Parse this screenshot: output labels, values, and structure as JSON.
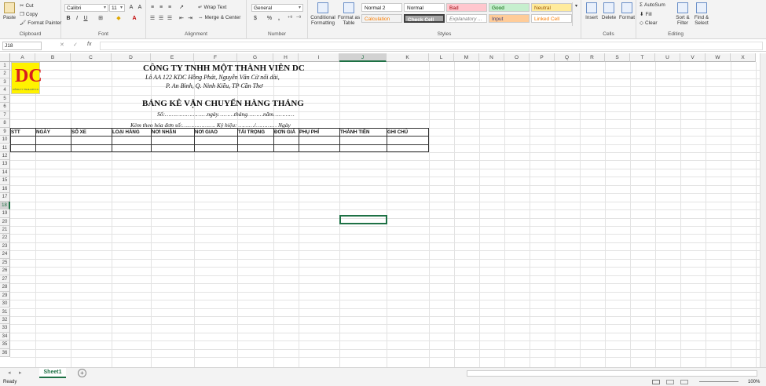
{
  "ribbon": {
    "clipboard": {
      "label": "Clipboard",
      "paste": "Paste",
      "cut": "Cut",
      "copy": "Copy",
      "format_painter": "Format Painter"
    },
    "font": {
      "label": "Font",
      "name": "Calibri",
      "size": "11"
    },
    "alignment": {
      "label": "Alignment",
      "wrap": "Wrap Text",
      "merge": "Merge & Center"
    },
    "number": {
      "label": "Number",
      "format": "General",
      "currency": "$",
      "percent": "%",
      "comma": ","
    },
    "styles": {
      "label": "Styles",
      "conditional": "Conditional Formatting",
      "format_table": "Format as Table",
      "cells": [
        {
          "text": "Normal 2",
          "bg": "#ffffff",
          "fg": "#111111"
        },
        {
          "text": "Normal",
          "bg": "#ffffff",
          "fg": "#111111"
        },
        {
          "text": "Bad",
          "bg": "#ffc7ce",
          "fg": "#9c0006"
        },
        {
          "text": "Good",
          "bg": "#c6efce",
          "fg": "#006100"
        },
        {
          "text": "Neutral",
          "bg": "#ffeb9c",
          "fg": "#9c5700"
        },
        {
          "text": "Calculation",
          "bg": "#f2f2f2",
          "fg": "#fa7d00"
        },
        {
          "text": "Check Cell",
          "bg": "#a5a5a5",
          "fg": "#ffffff"
        },
        {
          "text": "Explanatory ...",
          "bg": "#ffffff",
          "fg": "#7f7f7f"
        },
        {
          "text": "Input",
          "bg": "#ffcc99",
          "fg": "#3f3f76"
        },
        {
          "text": "Linked Cell",
          "bg": "#ffffff",
          "fg": "#fa7d00"
        }
      ]
    },
    "cells": {
      "label": "Cells",
      "insert": "Insert",
      "delete": "Delete",
      "format": "Format"
    },
    "editing": {
      "label": "Editing",
      "autosum": "AutoSum",
      "fill": "Fill",
      "clear": "Clear",
      "sort": "Sort & Filter",
      "find": "Find & Select"
    }
  },
  "formula_bar": {
    "name_box": "J18",
    "fx": "fx",
    "value": ""
  },
  "columns": [
    "A",
    "B",
    "C",
    "D",
    "E",
    "F",
    "G",
    "H",
    "I",
    "J",
    "K",
    "L",
    "M",
    "N",
    "O",
    "P",
    "Q",
    "R",
    "S",
    "T",
    "U",
    "V",
    "W",
    "X"
  ],
  "rows": [
    "1",
    "2",
    "3",
    "4",
    "5",
    "6",
    "7",
    "8",
    "9",
    "10",
    "11",
    "12",
    "13",
    "14",
    "15",
    "16",
    "17",
    "18",
    "19",
    "20",
    "21",
    "22",
    "23",
    "24",
    "25",
    "26",
    "27",
    "28",
    "29",
    "30",
    "31",
    "32",
    "33",
    "34",
    "35",
    "36"
  ],
  "sheet": {
    "company": "CÔNG TY TNHH MỘT THÀNH VIÊN DC",
    "address1": "Lô AA 122 KDC Hồng Phát, Nguyễn Văn Cừ nối dài,",
    "address2": "P. An Bình, Q. Ninh Kiều, TP Cần Thơ",
    "title": "BẢNG KÊ VẬN CHUYỂN HÀNG THÁNG",
    "number_line": "Số:……………………ngày………tháng………năm…………",
    "invoice_line": "Kèm theo hóa đơn số:………………. Ký hiệu:  ………/…………  Ngày",
    "logo_text": "DC",
    "logo_caption": "CÔNG TY TNHH MTV DC",
    "headers": [
      "STT",
      "NGÀY",
      "SỐ XE",
      "LOẠI HÀNG",
      "NƠI NHẬN",
      "NƠI GIAO",
      "TẢI TRỌNG",
      "ĐƠN GIÁ",
      "PHỤ PHÍ",
      "THÀNH TIỀN",
      "GHI CHÚ"
    ]
  },
  "tabs": {
    "sheet1": "Sheet1",
    "add": "+"
  },
  "status": {
    "ready": "Ready",
    "zoom": "100%"
  }
}
